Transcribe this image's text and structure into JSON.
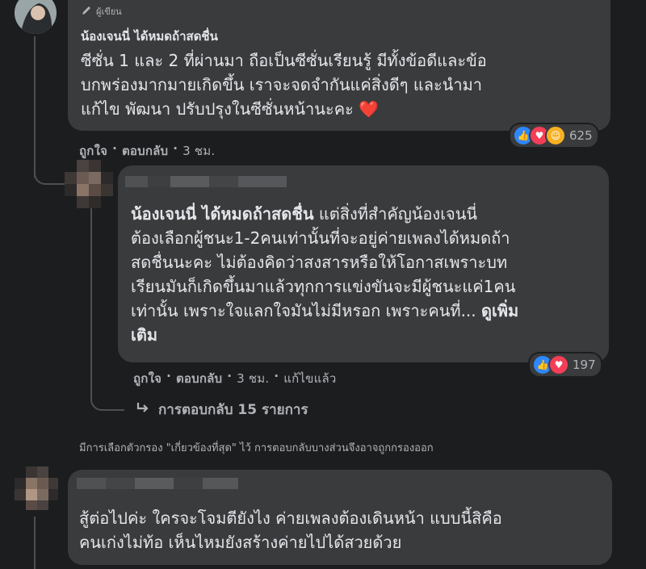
{
  "colors": {
    "background": "#1c1d1f",
    "bubble": "#3a3b3c",
    "text": "#e4e6eb",
    "muted": "#b0b3b8",
    "like": "#2d88ff",
    "love": "#f33e58",
    "care": "#f7b125"
  },
  "comments": [
    {
      "author_tag": "ผู้เขียน",
      "author_icon": "pencil-icon",
      "mention": "น้องเจนนี่ ได้หมดถ้าสดชื่น",
      "lines": [
        "ซีซั่น 1 และ 2 ที่ผ่านมา ถือเป็นซีซั่นเรียนรู้ มีทั้งข้อดีและข้อ",
        "บกพร่องมากมายเกิดขึ้น เราจะจดจำกันแค่สิ่งดีๆ และนำมา",
        "แก้ไข พัฒนา ปรับปรุงในซีซั่นหน้านะคะ ❤️"
      ],
      "reactions": {
        "icons": [
          "like-icon",
          "love-icon",
          "care-icon"
        ],
        "count": "625"
      },
      "actions": {
        "like": "ถูกใจ",
        "reply": "ตอบกลับ",
        "time": "3 ชม."
      }
    },
    {
      "mention": "น้องเจนนี่ ได้หมดถ้าสดชื่น",
      "lines": [
        "แต่สิ่งที่สำคัญน้องเจนนี่",
        "ต้องเลือกผู้ชนะ1-2คนเท่านั้นที่จะอยู่ค่ายเพลงได้หมดถ้า",
        "สดชื่นนะคะ ไม่ต้องคิดว่าสงสารหรือให้โอกาสเพราะบท",
        "เรียนมันก็เกิดขึ้นมาแล้วทุกการแข่งขันจะมีผู้ชนะแค่1คน",
        "เท่านั้น เพราะใจแลกใจมันไม่มีหรอก เพราะคนที่..."
      ],
      "see_more": "ดูเพิ่ม",
      "see_more_wrap": "เติม",
      "reactions": {
        "icons": [
          "like-icon",
          "love-icon"
        ],
        "count": "197"
      },
      "actions": {
        "like": "ถูกใจ",
        "reply": "ตอบกลับ",
        "time": "3 ชม.",
        "edited": "แก้ไขแล้ว"
      }
    },
    {
      "lines": [
        "สู้ต่อไปค่ะ ใครจะโจมตียังไง ค่ายเพลงต้องเดินหน้า แบบนี้สิคือ",
        "คนเก่งไม่ท้อ เห็นไหมยังสร้างค่ายไปได้สวยด้วย"
      ]
    }
  ],
  "replies_link": "การตอบกลับ 15 รายการ",
  "filter_notice": "มีการเลือกตัวกรอง \"เกี่ยวข้องที่สุด\" ไว้ การตอบกลับบางส่วนจึงอาจถูกกรองออก",
  "separator": "·"
}
